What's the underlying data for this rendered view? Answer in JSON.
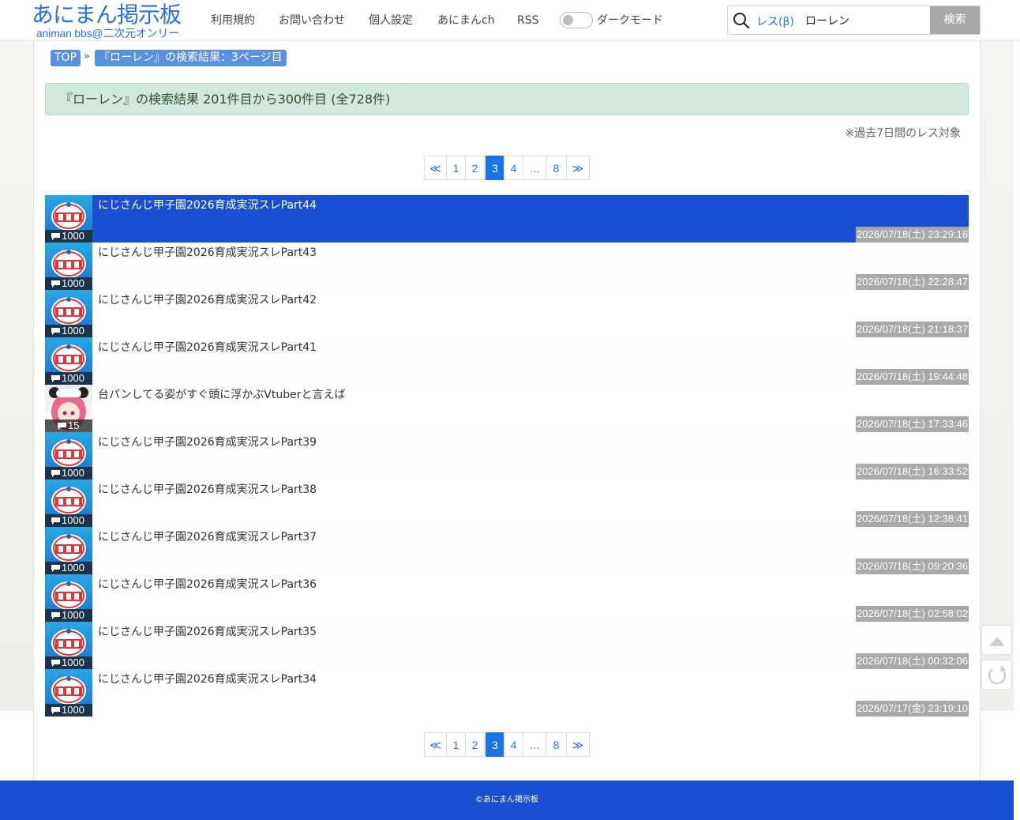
{
  "header": {
    "logo_main": "あにまん掲示板",
    "logo_sub": "animan bbs@二次元オンリー",
    "nav": [
      "利用規約",
      "お問い合わせ",
      "個人設定",
      "あにまんch",
      "RSS"
    ],
    "dark_mode_label": "ダークモード",
    "search_scope": "レス(β)",
    "search_value": "ローレン",
    "search_button": "検索"
  },
  "breadcrumb": {
    "top": "TOP",
    "separator": "»",
    "current": "『ローレン』の検索結果：3ページ目"
  },
  "result_banner": "『ローレン』の検索結果 201件目から300件目 (全728件)",
  "note": "※過去7日間のレス対象",
  "pagination": {
    "first": "≪",
    "pages": [
      "1",
      "2",
      "3",
      "4",
      "…",
      "8"
    ],
    "current": "3",
    "last": "≫"
  },
  "threads": [
    {
      "title": "にじさんじ甲子園2026育成実況スレPart44",
      "count": "1000",
      "date": "2026/07/18(土) 23:29:16",
      "thumb": "koshien-icon",
      "active": true
    },
    {
      "title": "にじさんじ甲子園2026育成実況スレPart43",
      "count": "1000",
      "date": "2026/07/18(土) 22:28:47",
      "thumb": "koshien-icon"
    },
    {
      "title": "にじさんじ甲子園2026育成実況スレPart42",
      "count": "1000",
      "date": "2026/07/18(土) 21:18:37",
      "thumb": "koshien-icon"
    },
    {
      "title": "にじさんじ甲子園2026育成実況スレPart41",
      "count": "1000",
      "date": "2026/07/18(土) 19:44:48",
      "thumb": "koshien-icon"
    },
    {
      "title": "台パンしてる姿がすぐ頭に浮かぶVtuberと言えば",
      "count": "15",
      "date": "2026/07/18(土) 17:33:46",
      "thumb": "vtuber-icon"
    },
    {
      "title": "にじさんじ甲子園2026育成実況スレPart39",
      "count": "1000",
      "date": "2026/07/18(土) 16:33:52",
      "thumb": "koshien-icon"
    },
    {
      "title": "にじさんじ甲子園2026育成実況スレPart38",
      "count": "1000",
      "date": "2026/07/18(土) 12:38:41",
      "thumb": "koshien-icon"
    },
    {
      "title": "にじさんじ甲子園2026育成実況スレPart37",
      "count": "1000",
      "date": "2026/07/18(土) 09:20:36",
      "thumb": "koshien-icon"
    },
    {
      "title": "にじさんじ甲子園2026育成実況スレPart36",
      "count": "1000",
      "date": "2026/07/18(土) 02:58:02",
      "thumb": "koshien-icon"
    },
    {
      "title": "にじさんじ甲子園2026育成実況スレPart35",
      "count": "1000",
      "date": "2026/07/18(土) 00:32:06",
      "thumb": "koshien-icon"
    },
    {
      "title": "にじさんじ甲子園2026育成実況スレPart34",
      "count": "1000",
      "date": "2026/07/17(金) 23:19:10",
      "thumb": "koshien-icon"
    }
  ],
  "side_buttons": [
    "scroll-top-icon",
    "reload-icon"
  ],
  "footer": "©あにまん掲示板",
  "colors": {
    "accent": "#1a4fd1",
    "link": "#2e6fdb",
    "banner": "#d2e8db",
    "date_badge": "#a9a9a9"
  }
}
